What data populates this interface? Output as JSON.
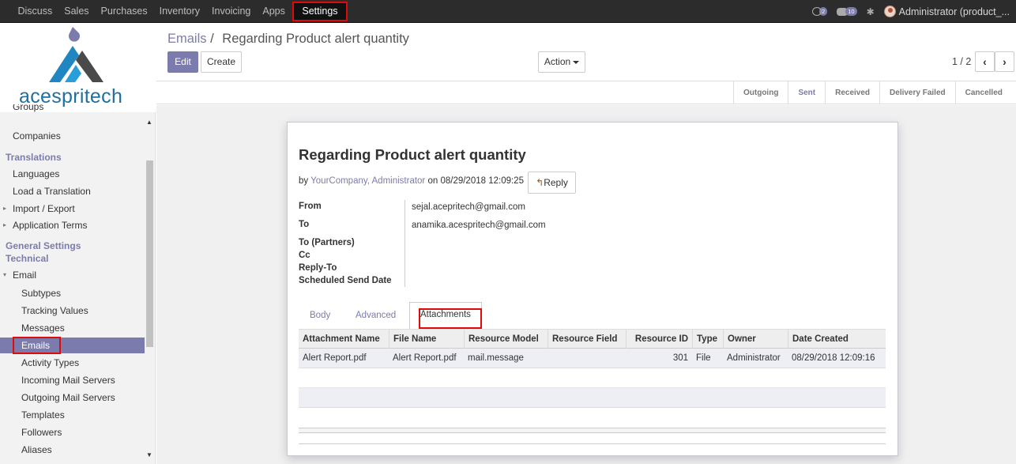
{
  "topbar": {
    "menu": [
      "Discuss",
      "Sales",
      "Purchases",
      "Inventory",
      "Invoicing",
      "Apps"
    ],
    "active_menu": "Settings",
    "messages_badge": "2",
    "activities_badge": "10",
    "user": "Administrator (product_..."
  },
  "sidebar": {
    "logo_text": "acespritech",
    "items": [
      {
        "label": "Groups"
      },
      {
        "label": "Companies"
      },
      {
        "label": "Translations"
      },
      {
        "label": "Languages"
      },
      {
        "label": "Load a Translation"
      },
      {
        "label": "Import / Export"
      },
      {
        "label": "Application Terms"
      },
      {
        "label": "General Settings"
      },
      {
        "label": "Technical"
      },
      {
        "label": "Email"
      },
      {
        "label": "Subtypes"
      },
      {
        "label": "Tracking Values"
      },
      {
        "label": "Messages"
      },
      {
        "label": "Emails"
      },
      {
        "label": "Activity Types"
      },
      {
        "label": "Incoming Mail Servers"
      },
      {
        "label": "Outgoing Mail Servers"
      },
      {
        "label": "Templates"
      },
      {
        "label": "Followers"
      },
      {
        "label": "Aliases"
      }
    ]
  },
  "breadcrumb": {
    "parent": "Emails",
    "separator": "/",
    "current": "Regarding Product alert quantity"
  },
  "buttons": {
    "edit": "Edit",
    "create": "Create",
    "action": "Action"
  },
  "pager": {
    "value": "1 / 2"
  },
  "status": {
    "stages": [
      "Outgoing",
      "Sent",
      "Received",
      "Delivery Failed",
      "Cancelled"
    ],
    "current": "Sent"
  },
  "message": {
    "subject": "Regarding Product alert quantity",
    "by_prefix": "by",
    "author": "YourCompany, Administrator",
    "on_text": "on 08/29/2018 12:09:25",
    "reply_label": "Reply",
    "fields": {
      "from_label": "From",
      "from_value": "sejal.acepritech@gmail.com",
      "to_label": "To",
      "to_value": "anamika.acespritech@gmail.com",
      "to_partners_label": "To (Partners)",
      "cc_label": "Cc",
      "reply_to_label": "Reply-To",
      "scheduled_label": "Scheduled Send Date"
    },
    "tabs": [
      "Body",
      "Advanced",
      "Attachments"
    ],
    "active_tab": "Attachments"
  },
  "attachments": {
    "columns": [
      "Attachment Name",
      "File Name",
      "Resource Model",
      "Resource Field",
      "Resource ID",
      "Type",
      "Owner",
      "Date Created"
    ],
    "rows": [
      {
        "attachment_name": "Alert Report.pdf",
        "file_name": "Alert Report.pdf",
        "resource_model": "mail.message",
        "resource_field": "",
        "resource_id": "301",
        "type": "File",
        "owner": "Administrator",
        "date_created": "08/29/2018 12:09:16"
      }
    ]
  },
  "colors": {
    "brand": "#7c7bad",
    "highlight": "#e10a0a",
    "topbar": "#2c2c2c"
  }
}
